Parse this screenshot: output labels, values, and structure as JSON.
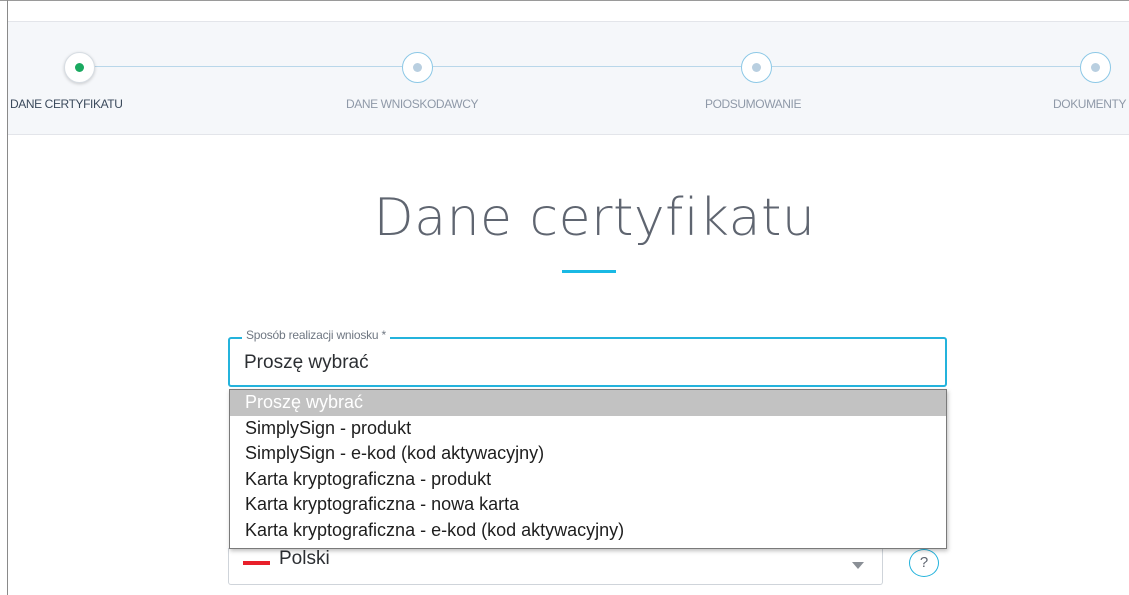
{
  "stepper": {
    "steps": [
      {
        "label": "DANE CERTYFIKATU",
        "state": "active"
      },
      {
        "label": "DANE WNIOSKODAWCY",
        "state": "pending"
      },
      {
        "label": "PODSUMOWANIE",
        "state": "pending"
      },
      {
        "label": "DOKUMENTY",
        "state": "pending"
      }
    ],
    "colors": {
      "active_dot": "#1aa960",
      "line": "#b9d7ea"
    }
  },
  "page": {
    "title": "Dane certyfikatu",
    "accent": "#19b9e4"
  },
  "realization_field": {
    "legend": "Sposób realizacji wniosku *",
    "value": "Proszę wybrać"
  },
  "realization_dropdown": {
    "options": [
      "Proszę wybrać",
      "SimplySign - produkt",
      "SimplySign - e-kod (kod aktywacyjny)",
      "Karta kryptograficzna - produkt",
      "Karta kryptograficzna - nowa karta",
      "Karta kryptograficzna - e-kod (kod aktywacyjny)"
    ],
    "highlighted": "Proszę wybrać"
  },
  "language_select": {
    "value": "Polski",
    "flag_icon": "poland-flag-icon"
  },
  "help_button": {
    "label": "?"
  }
}
